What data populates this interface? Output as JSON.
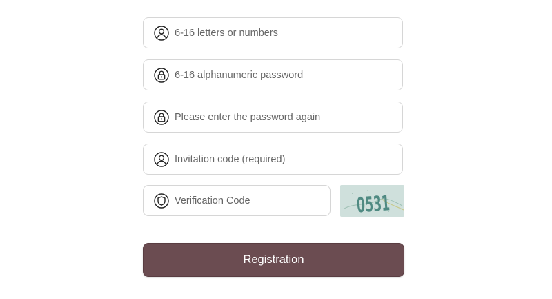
{
  "form": {
    "username": {
      "placeholder": "6-16 letters or numbers",
      "value": "",
      "icon": "user-icon"
    },
    "password": {
      "placeholder": "6-16 alphanumeric password",
      "value": "",
      "icon": "lock-icon"
    },
    "confirm_password": {
      "placeholder": "Please enter the password again",
      "value": "",
      "icon": "lock-icon"
    },
    "invitation_code": {
      "placeholder": "Invitation code (required)",
      "value": "",
      "icon": "user-icon"
    },
    "verification_code": {
      "placeholder": "Verification Code",
      "value": "",
      "icon": "shield-icon"
    },
    "captcha": {
      "text": "0531"
    },
    "submit_label": "Registration"
  },
  "colors": {
    "button_bg": "#6b4c51",
    "button_text": "#ffffff",
    "field_border": "#d6d6d6",
    "captcha_bg": "#cfe0dc",
    "captcha_text": "#4f8a82",
    "icon_stroke": "#222222"
  }
}
